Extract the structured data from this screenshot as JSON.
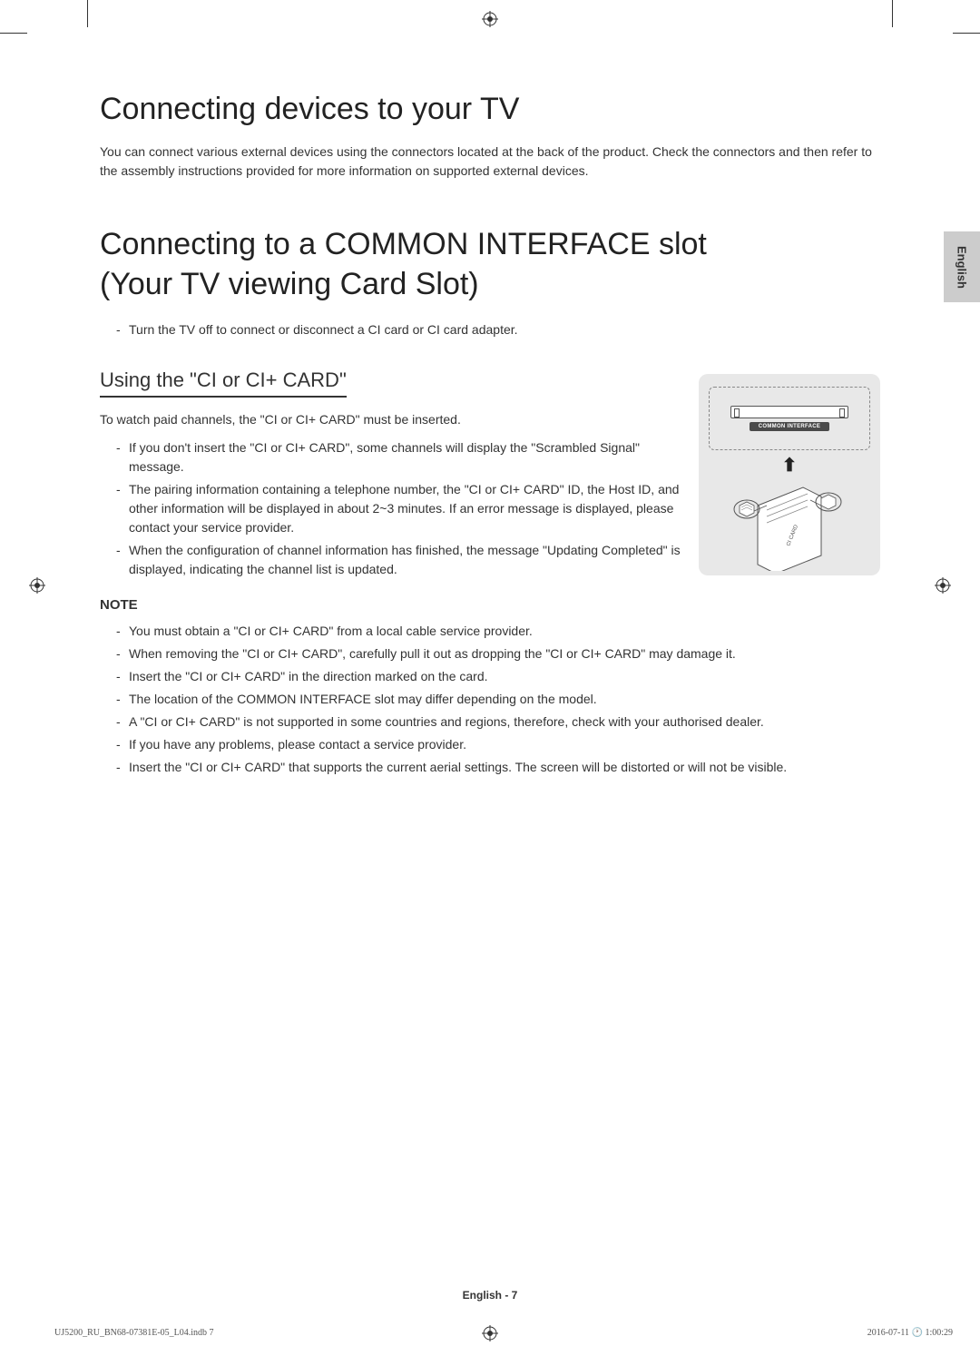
{
  "lang_tab": "English",
  "h1": "Connecting devices to your TV",
  "intro": "You can connect various external devices using the connectors located at the back of the product. Check the connectors and then refer to the assembly instructions provided for more information on supported external devices.",
  "h2": "Connecting to a COMMON INTERFACE slot (Your TV viewing Card Slot)",
  "pre_list": [
    "Turn the TV off to connect or disconnect a CI card or CI card adapter."
  ],
  "h3": "Using the \"CI or CI+ CARD\"",
  "p_after_h3": "To watch paid channels, the \"CI or CI+ CARD\" must be inserted.",
  "ci_bullets": [
    "If you don't insert the \"CI or CI+ CARD\", some channels will display the \"Scrambled Signal\" message.",
    "The pairing information containing a telephone number, the \"CI or CI+ CARD\" ID, the Host ID, and other information will be displayed in about 2~3 minutes. If an error message is displayed, please contact your service provider.",
    "When the configuration of channel information has finished, the message \"Updating Completed\" is displayed, indicating the channel list is updated."
  ],
  "note_heading": "NOTE",
  "note_bullets": [
    "You must obtain a \"CI or CI+ CARD\" from a local cable service provider.",
    "When removing the \"CI or CI+ CARD\", carefully pull it out as dropping the \"CI or CI+ CARD\" may damage it.",
    "Insert the \"CI or CI+ CARD\" in the direction marked on the card.",
    "The location of the COMMON INTERFACE slot may differ depending on the model.",
    "A \"CI or CI+ CARD\" is not supported in some countries and regions, therefore, check with your authorised dealer.",
    "If you have any problems, please contact a service provider.",
    "Insert the \"CI or CI+ CARD\" that supports the current aerial settings. The screen will be distorted or will not be visible."
  ],
  "diagram": {
    "slot_label": "COMMON INTERFACE"
  },
  "footer": {
    "page_label": "English - 7",
    "doc_ref": "UJ5200_RU_BN68-07381E-05_L04.indb   7",
    "timestamp": "2016-07-11   🕐 1:00:29"
  }
}
